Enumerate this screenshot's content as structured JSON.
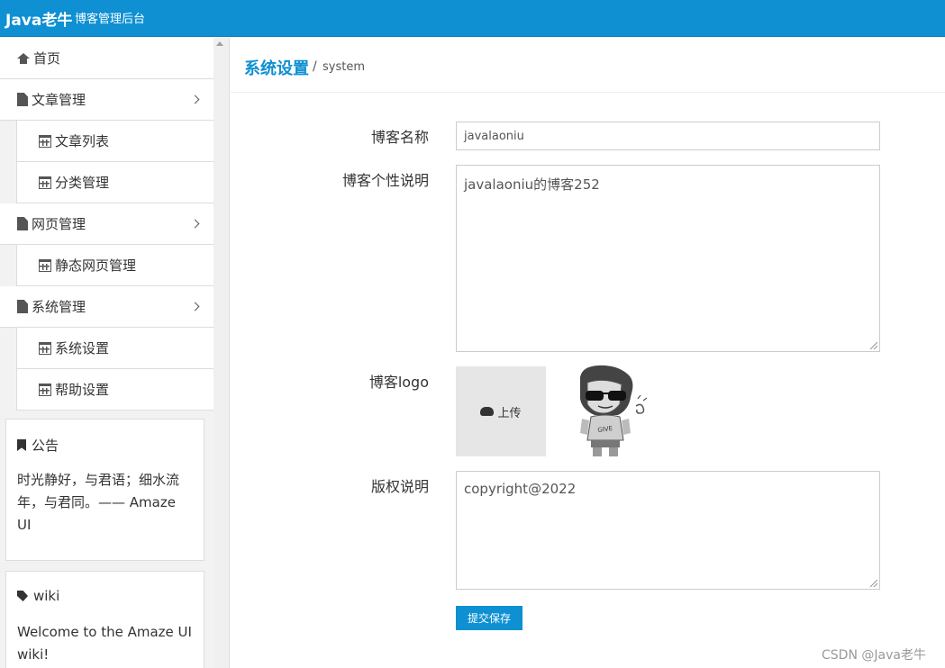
{
  "header": {
    "brand": "Java老牛",
    "subtitle": "博客管理后台"
  },
  "sidebar": {
    "items": [
      {
        "label": "首页",
        "icon": "home-icon"
      },
      {
        "label": "文章管理",
        "icon": "file-icon",
        "expandable": true
      },
      {
        "label": "文章列表",
        "icon": "calendar-icon"
      },
      {
        "label": "分类管理",
        "icon": "calendar-icon"
      },
      {
        "label": "网页管理",
        "icon": "file-icon",
        "expandable": true
      },
      {
        "label": "静态网页管理",
        "icon": "calendar-icon"
      },
      {
        "label": "系统管理",
        "icon": "file-icon",
        "expandable": true
      },
      {
        "label": "系统设置",
        "icon": "calendar-icon"
      },
      {
        "label": "帮助设置",
        "icon": "calendar-icon"
      }
    ],
    "notice": {
      "title": "公告",
      "line1": "时光静好，与君语；细水流",
      "line2": "年，与君同。—— Amaze",
      "line3": "UI"
    },
    "wiki": {
      "title": "wiki",
      "line1": "Welcome to the Amaze UI",
      "line2": "wiki!"
    }
  },
  "page": {
    "title": "系统设置",
    "separator": "/",
    "subtitle": "system"
  },
  "form": {
    "blog_name_label": "博客名称",
    "blog_name_value": "javalaoniu",
    "desc_label": "博客个性说明",
    "desc_value": "javalaoniu的博客252",
    "logo_label": "博客logo",
    "upload_label": "上传",
    "copyright_label": "版权说明",
    "copyright_value": "copyright@2022",
    "submit_label": "提交保存"
  },
  "watermark": "CSDN @Java老牛",
  "colors": {
    "primary": "#0e90d2",
    "sidebar_bg": "#f2f2f2",
    "upload_bg": "#e6e6e6"
  }
}
